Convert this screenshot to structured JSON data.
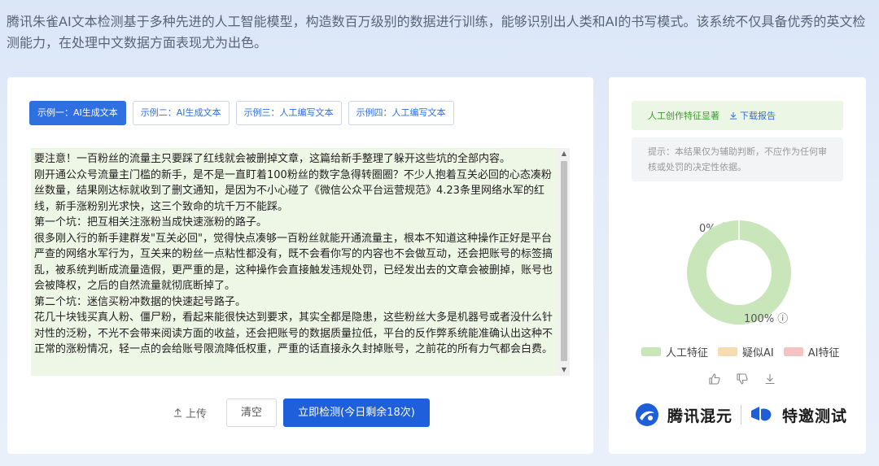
{
  "intro": "腾讯朱雀AI文本检测基于多种先进的人工智能模型，构造数百万级别的数据进行训练，能够识别出人类和AI的书写模式。该系统不仅具备优秀的英文检测能力，在处理中文数据方面表现尤为出色。",
  "tabs": [
    {
      "label": "示例一：AI生成文本",
      "active": true
    },
    {
      "label": "示例二：AI生成文本",
      "active": false
    },
    {
      "label": "示例三：人工编写文本",
      "active": false
    },
    {
      "label": "示例四：人工编写文本",
      "active": false
    }
  ],
  "input_text": "要注意！一百粉丝的流量主只要踩了红线就会被删掉文章，这篇给新手整理了躲开这些坑的全部内容。\n刚开通公众号流量主门槛的新手，是不是一直盯着100粉丝的数字急得转圈圈？不少人抱着互关必回的心态凑粉丝数量，结果刚达标就收到了删文通知，是因为不小心碰了《微信公众平台运营规范》4.23条里网络水军的红线，新手涨粉别光求快，这三个致命的坑千万不能踩。\n第一个坑：把互相关注涨粉当成快速涨粉的路子。\n很多刚入行的新手建群发\"互关必回\"，觉得快点凑够一百粉丝就能开通流量主，根本不知道这种操作正好是平台严查的网络水军行为，互关来的粉丝一点粘性都没有，既不会看你写的内容也不会做互动，还会把账号的标签搞乱，被系统判断成流量造假，更严重的是，这种操作会直接触发违规处罚，已经发出去的文章会被删掉，账号也会被降权，之后的自然流量就彻底断掉了。\n第二个坑：迷信买粉冲数据的快速起号路子。\n花几十块钱买真人粉、僵尸粉，看起来能很快达到要求，其实全都是隐患，这些粉丝大多是机器号或者没什么针对性的泛粉，不光不会带来阅读方面的收益，还会把账号的数据质量拉低，平台的反作弊系统能准确认出这种不正常的涨粉情况，轻一点的会给账号限流降低权重，严重的话直接永久封掉账号，之前花的所有力气都会白费。",
  "actions": {
    "upload": "上传",
    "clear": "清空",
    "detect": "立即检测(今日剩余18次)"
  },
  "result": {
    "banner": "人工创作特征显著",
    "download": "下载报告",
    "hint": "提示：本结果仅为辅助判断，不应作为任何审核或处罚的决定性依据。",
    "top_label": "0% ⓘ",
    "bottom_label": "100% ⓘ"
  },
  "chart_data": {
    "type": "pie",
    "categories": [
      "人工特征",
      "疑似AI",
      "AI特征"
    ],
    "values": [
      100,
      0,
      0
    ],
    "colors": [
      "#c8e6b9",
      "#f6dcb0",
      "#f6c3c3"
    ]
  },
  "legend": [
    {
      "label": "人工特征",
      "color": "#c8e6b9"
    },
    {
      "label": "疑似AI",
      "color": "#f6dcb0"
    },
    {
      "label": "AI特征",
      "color": "#f6c3c3"
    }
  ],
  "logos": {
    "hunyuan": "腾讯混元",
    "invite": "特邀测试"
  }
}
